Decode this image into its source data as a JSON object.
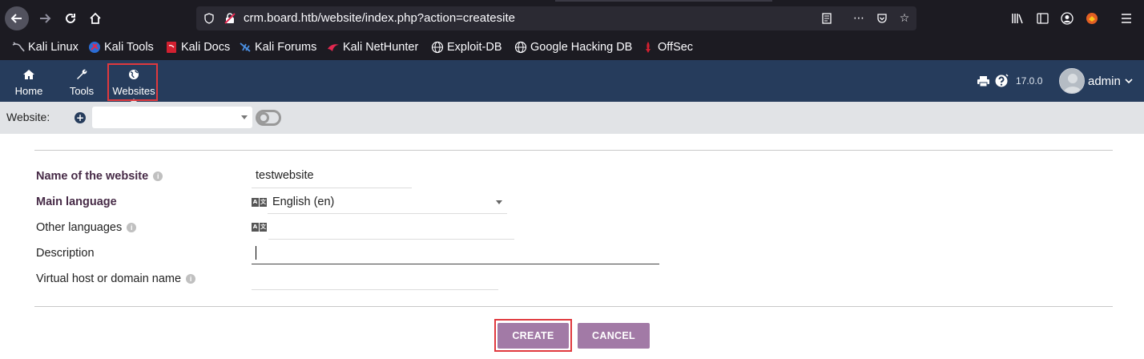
{
  "browser": {
    "url": "crm.board.htb/website/index.php?action=createsite",
    "bookmarks": [
      {
        "label": "Kali Linux",
        "icon": "kali-dragon-icon"
      },
      {
        "label": "Kali Tools",
        "icon": "kali-tools-icon"
      },
      {
        "label": "Kali Docs",
        "icon": "kali-docs-icon"
      },
      {
        "label": "Kali Forums",
        "icon": "kali-forums-icon"
      },
      {
        "label": "Kali NetHunter",
        "icon": "nethunter-icon"
      },
      {
        "label": "Exploit-DB",
        "icon": "globe-icon"
      },
      {
        "label": "Google Hacking DB",
        "icon": "globe-icon"
      },
      {
        "label": "OffSec",
        "icon": "offsec-icon"
      }
    ]
  },
  "topnav": {
    "items": [
      {
        "label": "Home",
        "icon": "home-icon"
      },
      {
        "label": "Tools",
        "icon": "wrench-icon"
      },
      {
        "label": "Websites",
        "icon": "globe-icon"
      }
    ],
    "version": "17.0.0",
    "user": "admin"
  },
  "website_bar": {
    "label": "Website:",
    "selected": ""
  },
  "form": {
    "fields": [
      {
        "label": "Name of the website",
        "value": "testwebsite",
        "required": true,
        "info": true
      },
      {
        "label": "Main language",
        "value": "English (en)",
        "required": true,
        "info": false
      },
      {
        "label": "Other languages",
        "value": "",
        "required": false,
        "info": true
      },
      {
        "label": "Description",
        "value": "",
        "required": false,
        "info": false
      },
      {
        "label": "Virtual host or domain name",
        "value": "",
        "required": false,
        "info": true
      }
    ],
    "create_label": "CREATE",
    "cancel_label": "CANCEL"
  },
  "colors": {
    "browser_bg": "#1c1b22",
    "topbar": "#263c5c",
    "button": "#a27aa6",
    "highlight": "#e0393e",
    "required_label": "#472b47"
  }
}
